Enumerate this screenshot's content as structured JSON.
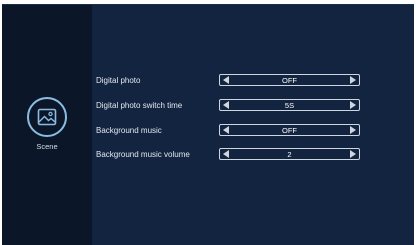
{
  "sidebar": {
    "scene_label": "Scene",
    "scene_icon": "image-icon"
  },
  "settings": [
    {
      "label": "Digital photo",
      "value": "OFF"
    },
    {
      "label": "Digital photo switch time",
      "value": "5S"
    },
    {
      "label": "Background music",
      "value": "OFF"
    },
    {
      "label": "Background music volume",
      "value": "2"
    }
  ],
  "colors": {
    "background": "#122138",
    "sidebar": "#0b1729",
    "accent": "#8bbde3"
  }
}
